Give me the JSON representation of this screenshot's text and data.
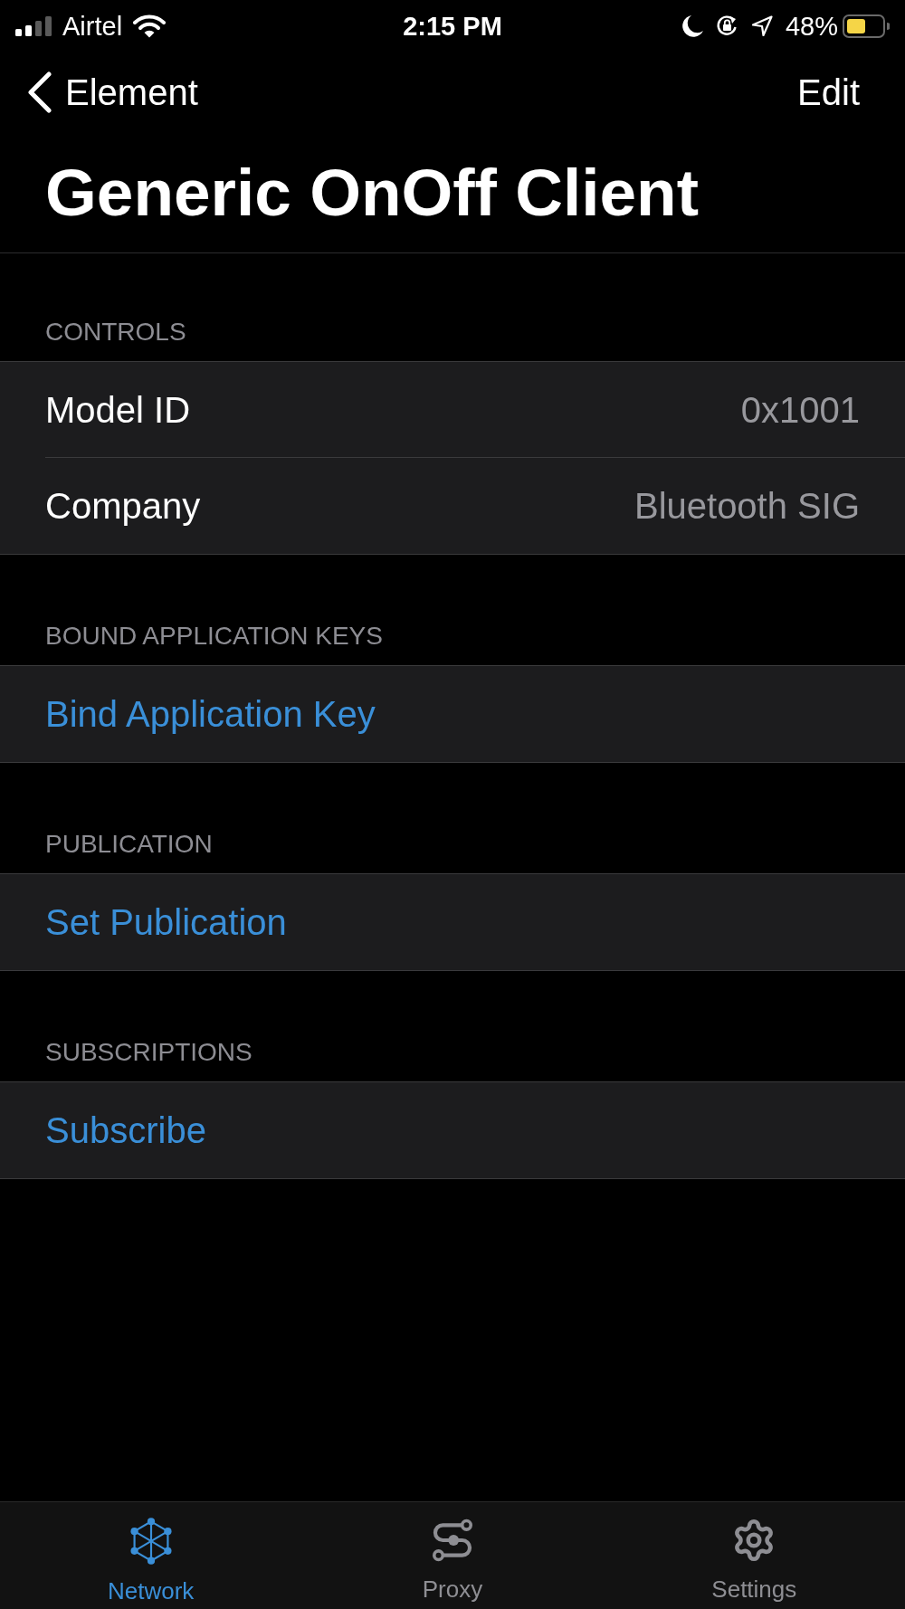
{
  "status_bar": {
    "carrier": "Airtel",
    "time": "2:15 PM",
    "battery": "48%"
  },
  "nav_bar": {
    "back": "Element",
    "action": "Edit"
  },
  "title": "Generic OnOff Client",
  "sections": [
    {
      "header": "CONTROLS",
      "rows": [
        {
          "kind": "value",
          "label": "Model ID",
          "value": "0x1001"
        },
        {
          "kind": "value",
          "label": "Company",
          "value": "Bluetooth SIG"
        }
      ]
    },
    {
      "header": "BOUND APPLICATION KEYS",
      "rows": [
        {
          "kind": "action",
          "label": "Bind Application Key"
        }
      ]
    },
    {
      "header": "PUBLICATION",
      "rows": [
        {
          "kind": "action",
          "label": "Set Publication"
        }
      ]
    },
    {
      "header": "SUBSCRIPTIONS",
      "rows": [
        {
          "kind": "action",
          "label": "Subscribe"
        }
      ]
    }
  ],
  "tab_bar": [
    {
      "label": "Network",
      "selected": true
    },
    {
      "label": "Proxy",
      "selected": false
    },
    {
      "label": "Settings",
      "selected": false
    }
  ]
}
